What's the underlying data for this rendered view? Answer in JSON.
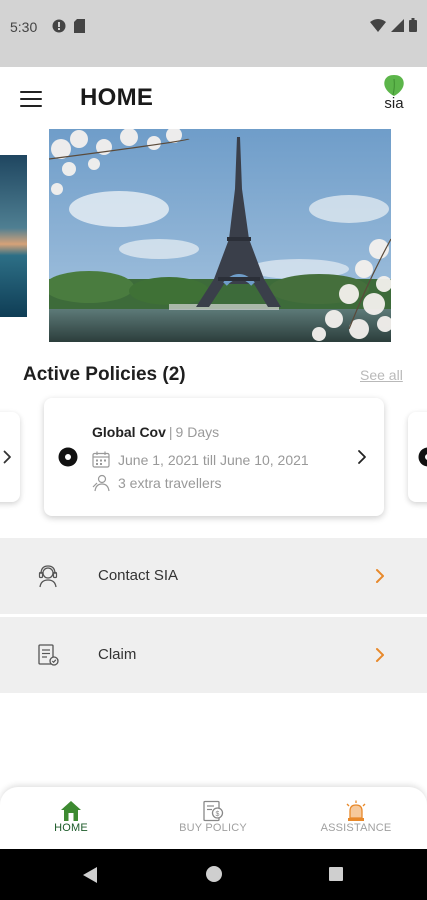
{
  "status_bar": {
    "time": "5:30",
    "icons": [
      "notification-icon",
      "sim-icon",
      "wifi-icon",
      "signal-icon",
      "battery-icon"
    ]
  },
  "header": {
    "title": "HOME",
    "logo_text": "sia"
  },
  "carousel": {
    "images": [
      "sea-landscape-image",
      "eiffel-tower-image"
    ]
  },
  "active_policies": {
    "title": "Active Policies (2)",
    "see_all": "See all",
    "card": {
      "name": "Global Cov",
      "separator": "|",
      "duration": "9 Days",
      "dates": "June 1, 2021 till June 10, 2021",
      "travellers": "3 extra travellers"
    }
  },
  "menu": {
    "contact": "Contact SIA",
    "claim": "Claim"
  },
  "bottom_nav": {
    "home": "HOME",
    "buy_policy": "BUY POLICY",
    "assistance": "ASSISTANCE"
  },
  "colors": {
    "accent_orange": "#e8892b",
    "brand_green": "#5cb54a",
    "active_nav": "#1d5b2a",
    "status_bar": "#d3d3d3",
    "menu_row": "#efefef"
  }
}
